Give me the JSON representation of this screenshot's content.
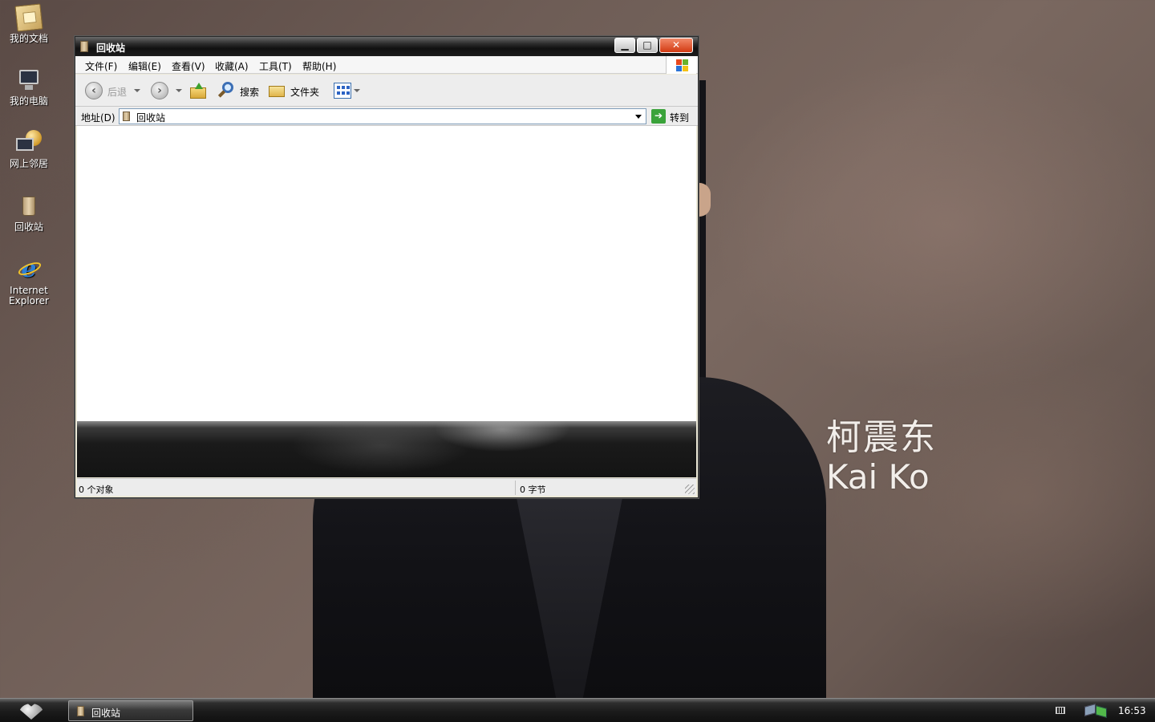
{
  "desktop": {
    "icons": [
      {
        "label": "我的文档",
        "icon": "my-documents-icon"
      },
      {
        "label": "我的电脑",
        "icon": "my-computer-icon"
      },
      {
        "label": "网上邻居",
        "icon": "network-places-icon"
      },
      {
        "label": "回收站",
        "icon": "recycle-bin-icon"
      },
      {
        "label": "Internet Explorer",
        "icon": "internet-explorer-icon"
      }
    ],
    "wallpaper_caption": {
      "chinese": "柯震东",
      "english": "Kai Ko"
    }
  },
  "window": {
    "title": "回收站",
    "title_icon": "recycle-bin-icon",
    "controls": {
      "minimize": "▁",
      "maximize": "□",
      "close": "✕"
    },
    "menu": [
      {
        "label": "文件(F)"
      },
      {
        "label": "编辑(E)"
      },
      {
        "label": "查看(V)"
      },
      {
        "label": "收藏(A)"
      },
      {
        "label": "工具(T)"
      },
      {
        "label": "帮助(H)"
      }
    ],
    "toolbar": {
      "back_label": "后退",
      "search_label": "搜索",
      "folders_label": "文件夹"
    },
    "address": {
      "label": "地址(D)",
      "value": "回收站",
      "go_label": "转到",
      "go_arrow": "➔"
    },
    "status": {
      "objects": "0 个对象",
      "size": "0 字节"
    }
  },
  "taskbar": {
    "items": [
      {
        "label": "回收站",
        "icon": "recycle-bin-icon"
      }
    ],
    "clock": "16:53"
  },
  "colors": {
    "window_frame": "#1c1c1c",
    "menubar_bg": "#f6f6f6",
    "content_bg": "#ffffff",
    "go_button": "#3aa33a",
    "close_button": "#d23a12"
  }
}
